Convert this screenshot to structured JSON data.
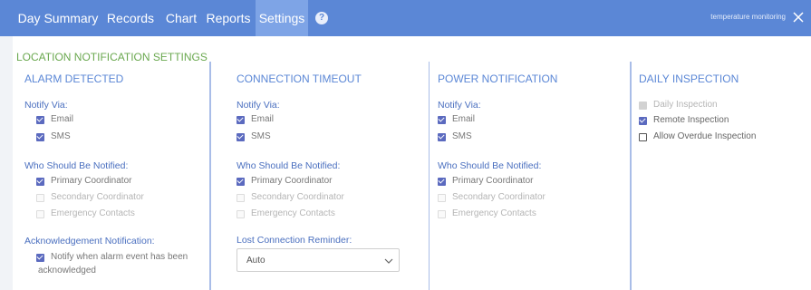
{
  "nav": {
    "tabs": [
      {
        "label": "Day Summary",
        "active": false
      },
      {
        "label": "Records",
        "active": false
      },
      {
        "label": "Chart",
        "active": false
      },
      {
        "label": "Reports",
        "active": false
      },
      {
        "label": "Settings",
        "active": true
      }
    ],
    "help_icon": "?",
    "sub_text": "temperature monitoring",
    "close_icon": "close-icon"
  },
  "page_title": "LOCATION NOTIFICATION SETTINGS",
  "columns": [
    {
      "heading": "ALARM DETECTED",
      "notify_via_label": "Notify Via:",
      "notify_via": [
        {
          "label": "Email",
          "checked": true
        },
        {
          "label": "SMS",
          "checked": true
        }
      ],
      "who_label": "Who Should Be Notified:",
      "who": [
        {
          "label": "Primary Coordinator",
          "checked": true
        },
        {
          "label": "Secondary Coordinator",
          "checked": false
        },
        {
          "label": "Emergency Contacts",
          "checked": false
        }
      ],
      "extra_label": "Acknowledgement Notification:",
      "extra_option": {
        "label_line1": "Notify when alarm event has been",
        "label_line2": "acknowledged",
        "checked": true
      }
    },
    {
      "heading": "CONNECTION TIMEOUT",
      "notify_via_label": "Notify Via:",
      "notify_via": [
        {
          "label": "Email",
          "checked": true
        },
        {
          "label": "SMS",
          "checked": true
        }
      ],
      "who_label": "Who Should Be Notified:",
      "who": [
        {
          "label": "Primary Coordinator",
          "checked": true
        },
        {
          "label": "Secondary Coordinator",
          "checked": false
        },
        {
          "label": "Emergency Contacts",
          "checked": false
        }
      ],
      "extra_label": "Lost Connection Reminder:",
      "select_value": "Auto"
    },
    {
      "heading": "POWER NOTIFICATION",
      "notify_via_label": "Notify Via:",
      "notify_via": [
        {
          "label": "Email",
          "checked": true
        },
        {
          "label": "SMS",
          "checked": true
        }
      ],
      "who_label": "Who Should Be Notified:",
      "who": [
        {
          "label": "Primary Coordinator",
          "checked": true
        },
        {
          "label": "Secondary Coordinator",
          "checked": false
        },
        {
          "label": "Emergency Contacts",
          "checked": false
        }
      ]
    },
    {
      "heading": "DAILY INSPECTION",
      "options": [
        {
          "label": "Daily Inspection",
          "checked": true,
          "disabled": true
        },
        {
          "label": "Remote Inspection",
          "checked": true,
          "disabled": false
        },
        {
          "label": "Allow Overdue Inspection",
          "checked": false,
          "disabled": false
        }
      ]
    }
  ],
  "colors": {
    "nav_bg": "#5b87d6",
    "active_tab": "#7ea4e6",
    "title_green": "#6aa84f",
    "heading_blue": "#5b87d6",
    "checkbox": "#5b6abf",
    "column_border": "#a9bde8"
  }
}
